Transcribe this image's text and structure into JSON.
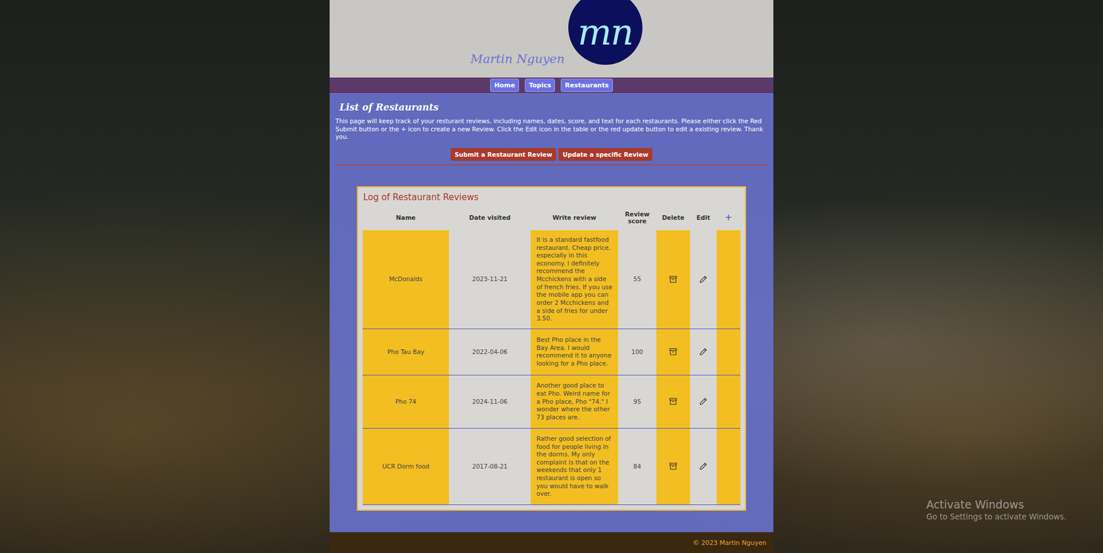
{
  "header": {
    "logo": "mn",
    "name": "Martin Nguyen"
  },
  "nav": [
    {
      "label": "Home"
    },
    {
      "label": "Topics"
    },
    {
      "label": "Restaurants"
    }
  ],
  "page": {
    "title": "List of Restaurants",
    "intro": "This page will keep track of your resturant reviews, including names, dates, score, and text for each restaurants. Please either click the Red Submit button or the + icon to create a new Review. Click the Edit icon in the table or the red update button to edit a existing review. Thank you.",
    "buttons": [
      "Submit a Restaurant Review",
      "Update a specific Review"
    ]
  },
  "table": {
    "title": "Log of Restaurant Reviews",
    "columns": [
      "Name",
      "Date visited",
      "Write review",
      "Review score",
      "Delete",
      "Edit",
      "+"
    ],
    "rows": [
      [
        "McDonalds",
        "2023-11-21",
        "It is a standard fastfood restaurant. Cheap price, especially in this economy. I definitely recommend the Mcchickens with a side of french fries. If you use the mobile app you can order 2 Mcchickens and a side of fries for under 3.50.",
        "55"
      ],
      [
        "Pho Tau Bay",
        "2022-04-06",
        "Best Pho place in the Bay Area. I would recommend it to anyone looking for a Pho place.",
        "100"
      ],
      [
        "Pho 74",
        "2024-11-06",
        "Another good place to eat Pho. Weird name for a Pho place, Pho \"74.\" I wonder where the other 73 places are.",
        "95"
      ],
      [
        "UCR Dorm food",
        "2017-08-21",
        "Rather good selection of food for people living in the dorms. My only complaint is that on the weekends that only 1 restaurant is open so you would have to walk over.",
        "84"
      ]
    ]
  },
  "footer": "© 2023 Martin Nguyen",
  "watermark": {
    "title": "Activate Windows",
    "subtitle": "Go to Settings to activate Windows."
  }
}
